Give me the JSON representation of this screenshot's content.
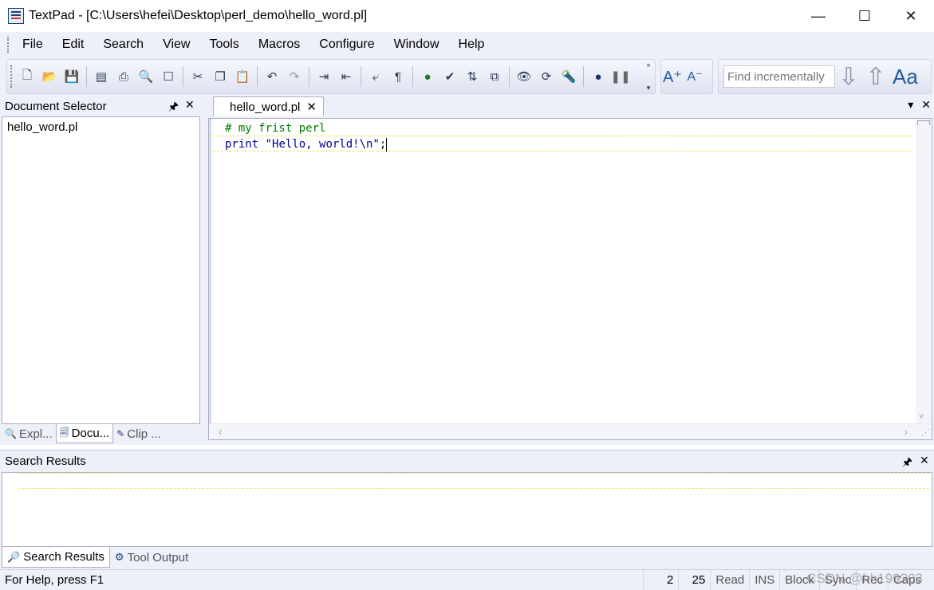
{
  "window": {
    "title": "TextPad - [C:\\Users\\hefei\\Desktop\\perl_demo\\hello_word.pl]",
    "minimize": "—",
    "maximize": "☐",
    "close": "✕"
  },
  "menu": [
    "File",
    "Edit",
    "Search",
    "View",
    "Tools",
    "Macros",
    "Configure",
    "Window",
    "Help"
  ],
  "toolbar": {
    "find_placeholder": "Find incrementally",
    "font_larger": "A⁺",
    "font_smaller": "A⁻",
    "match_case": "Aa",
    "find_next": "⇩",
    "find_prev": "⇧"
  },
  "doc_selector": {
    "title": "Document Selector",
    "pin": "📌",
    "close": "✕",
    "files": [
      "hello_word.pl"
    ],
    "tabs": [
      "Expl...",
      "Docu...",
      "Clip ..."
    ]
  },
  "editor": {
    "tab_label": "hello_word.pl",
    "tab_close": "✕",
    "lines": {
      "line1_comment": "# my frist perl",
      "line2_keyword": "print",
      "line2_string": "\"Hello, world!\\n\"",
      "line2_end": ";"
    }
  },
  "search_results": {
    "title": "Search Results",
    "tabs": [
      "Search Results",
      "Tool Output"
    ]
  },
  "status": {
    "help": "For Help, press F1",
    "line": "2",
    "column": "25",
    "read": "Read",
    "ins": "INS",
    "block": "Block",
    "sync": "Sync",
    "rec": "Rec",
    "caps": "Caps"
  },
  "watermark": "CSDN @hh199203"
}
